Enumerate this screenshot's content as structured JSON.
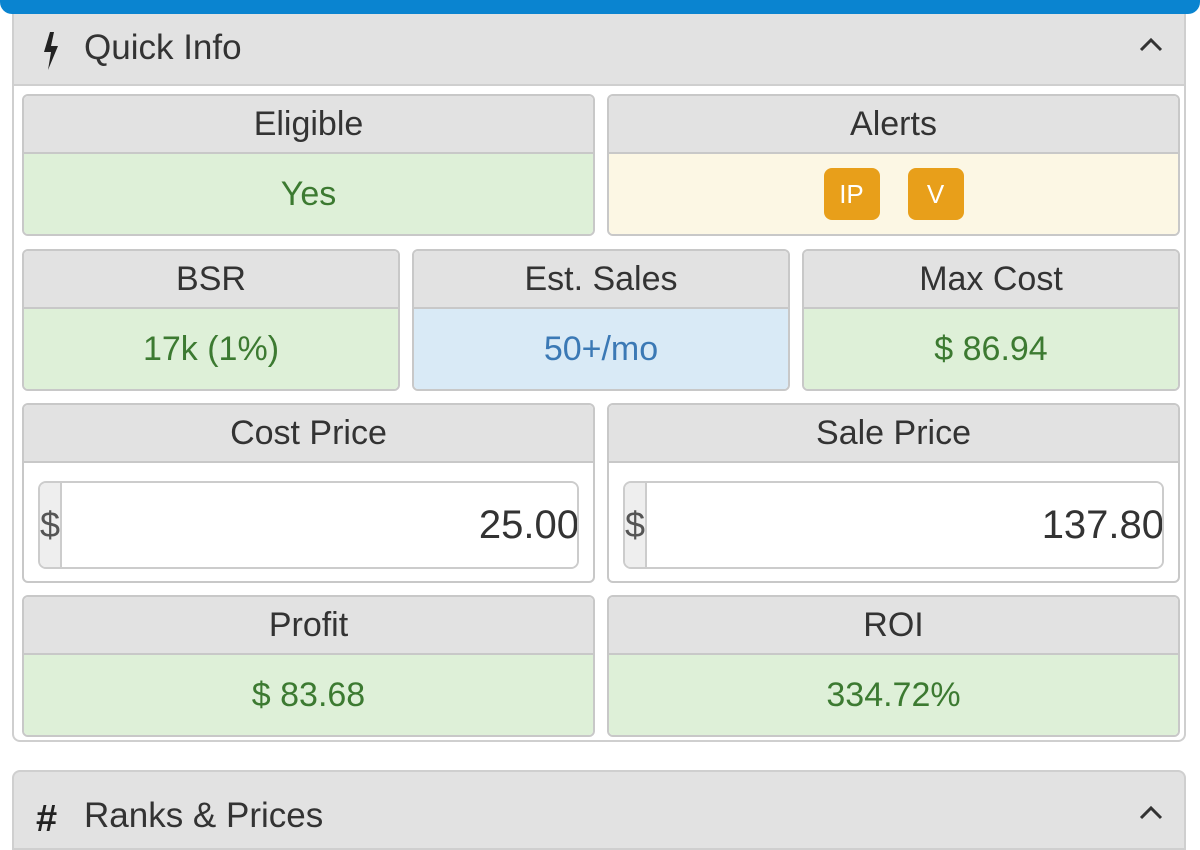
{
  "quick_info": {
    "title": "Quick Info",
    "icon": "bolt-icon",
    "eligible": {
      "label": "Eligible",
      "value": "Yes"
    },
    "alerts": {
      "label": "Alerts",
      "badges": [
        "IP",
        "V"
      ]
    },
    "bsr": {
      "label": "BSR",
      "value": "17k (1%)"
    },
    "est_sales": {
      "label": "Est. Sales",
      "value": "50+/mo"
    },
    "max_cost": {
      "label": "Max Cost",
      "value": "$ 86.94"
    },
    "cost_price": {
      "label": "Cost Price",
      "currency": "$",
      "value": "25.00"
    },
    "sale_price": {
      "label": "Sale Price",
      "currency": "$",
      "value": "137.80"
    },
    "profit": {
      "label": "Profit",
      "value": "$ 83.68"
    },
    "roi": {
      "label": "ROI",
      "value": "334.72%"
    }
  },
  "ranks_prices": {
    "title": "Ranks & Prices",
    "icon": "hash-icon"
  },
  "colors": {
    "accent": "#0a84d0",
    "success_bg": "#def0d8",
    "success_text": "#3c7a31",
    "info_bg": "#d9eaf6",
    "info_text": "#3b79b5",
    "warning_bg": "#fcf7e4",
    "badge": "#e89f1a"
  }
}
